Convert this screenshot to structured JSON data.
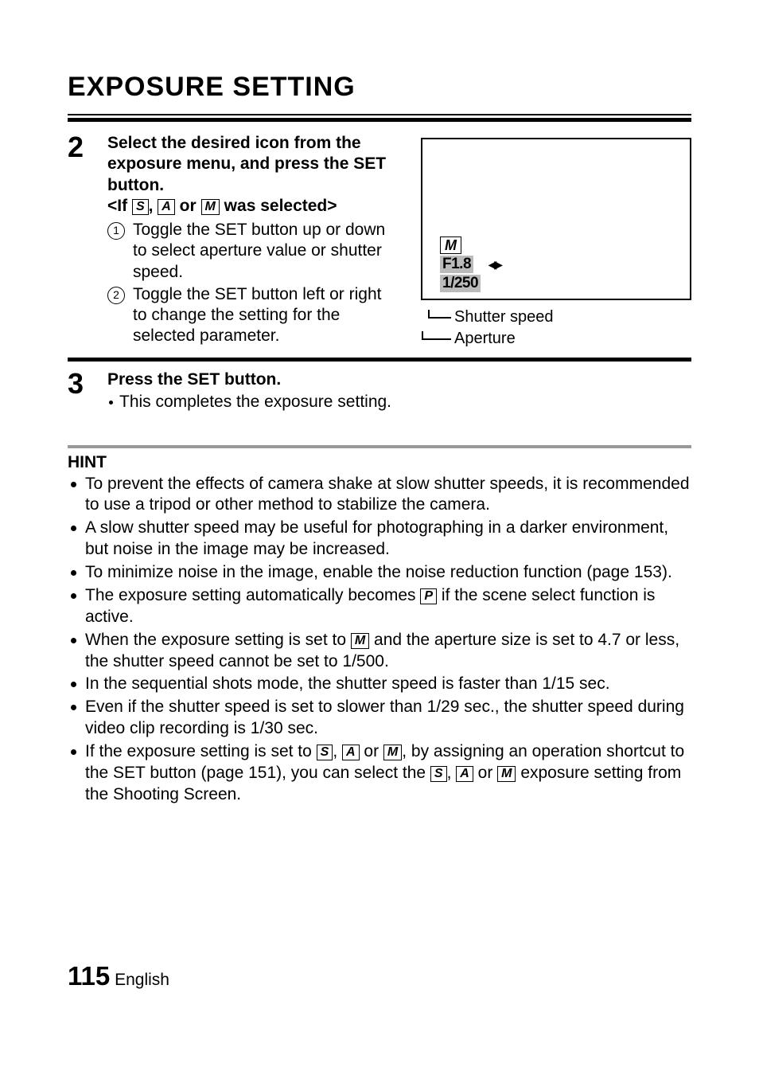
{
  "title": "EXPOSURE SETTING",
  "step2": {
    "num": "2",
    "line1": "Select the desired icon from the exposure menu, and press the SET button.",
    "line2_prefix": "<If ",
    "line2_sep1": ", ",
    "line2_sep2": " or ",
    "line2_suffix": " was selected>",
    "sub1_num": "1",
    "sub1_text": "Toggle the SET button up or down to select aperture value or shutter speed.",
    "sub2_num": "2",
    "sub2_text": "Toggle the SET button left or right to change the setting for the selected parameter."
  },
  "diagram": {
    "mode": "M",
    "aperture": "F1.8",
    "shutter": "1/250",
    "label_shutter": "Shutter speed",
    "label_aperture": "Aperture"
  },
  "step3": {
    "num": "3",
    "line1": "Press the SET button.",
    "bullet": "This completes the exposure setting."
  },
  "hint": {
    "title": "HINT",
    "b1": "To prevent the effects of camera shake at slow shutter speeds, it is recommended to use a tripod or other method to stabilize the camera.",
    "b2": "A slow shutter speed may be useful for photographing in a darker environment, but noise in the image may be increased.",
    "b3": "To minimize noise in the image, enable the noise reduction function (page 153).",
    "b4_pre": "The exposure setting automatically becomes ",
    "b4_post": " if the scene select function is active.",
    "b5_pre": "When the exposure setting is set to ",
    "b5_post": " and the aperture size is set to 4.7 or less, the shutter speed cannot be set to 1/500.",
    "b6": "In the sequential shots mode, the shutter speed is faster than 1/15 sec.",
    "b7": "Even if the shutter speed is set to slower than 1/29 sec., the shutter speed during video clip recording is 1/30 sec.",
    "b8_a": "If the exposure setting is set to ",
    "b8_b": ", ",
    "b8_c": " or ",
    "b8_d": ", by assigning an operation shortcut to the SET button (page 151), you can select the ",
    "b8_e": ", ",
    "b8_f": " or ",
    "b8_g": " exposure setting from the Shooting Screen."
  },
  "icons": {
    "S": "S",
    "A": "A",
    "M": "M",
    "P": "P"
  },
  "footer": {
    "page": "115",
    "lang": "English"
  }
}
